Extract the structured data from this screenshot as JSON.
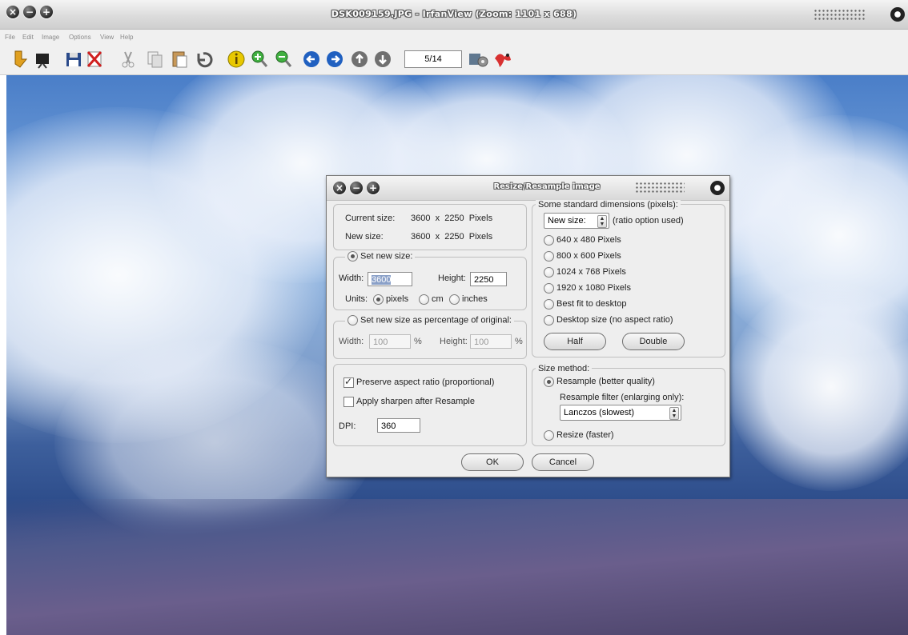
{
  "window": {
    "title": "DSK009159.JPG - IrfanView (Zoom: 1101 x 688)",
    "menu": [
      "File",
      "Edit",
      "Image",
      "Options",
      "View",
      "Help"
    ],
    "page_counter": "5/14"
  },
  "toolbar_icons": [
    "open-folder-icon",
    "slideshow-icon",
    "save-icon",
    "delete-icon",
    "cut-icon",
    "copy-icon",
    "paste-icon",
    "undo-icon",
    "info-icon",
    "zoom-in-icon",
    "zoom-out-icon",
    "previous-icon",
    "next-icon",
    "first-icon",
    "last-icon",
    "settings-icon",
    "irfanview-logo-icon"
  ],
  "dialog": {
    "title": "Resize/Resample image",
    "current_size_label": "Current size:",
    "current_size_value": "3600  x  2250  Pixels",
    "new_size_label": "New size:",
    "new_size_value": "3600  x  2250  Pixels",
    "set_new_size": {
      "label": "Set new size:",
      "selected": true,
      "width_label": "Width:",
      "width_value": "3600",
      "height_label": "Height:",
      "height_value": "2250",
      "units_label": "Units:",
      "units": [
        "pixels",
        "cm",
        "inches"
      ],
      "selected_unit": "pixels"
    },
    "percentage": {
      "label": "Set new size as percentage of original:",
      "selected": false,
      "width_label": "Width:",
      "width_value": "100",
      "height_label": "Height:",
      "height_value": "100",
      "unit": "%"
    },
    "options": {
      "preserve_aspect": "Preserve aspect ratio (proportional)",
      "preserve_checked": true,
      "sharpen": "Apply sharpen after Resample",
      "sharpen_checked": false,
      "dpi_label": "DPI:",
      "dpi_value": "360"
    },
    "standard": {
      "legend": "Some standard dimensions (pixels):",
      "dropdown_value": "New size:",
      "ratio_note": "(ratio option used)",
      "presets": [
        "640 x 480 Pixels",
        "800 x 600 Pixels",
        "1024 x 768 Pixels",
        "1920 x 1080 Pixels",
        "Best fit to desktop",
        "Desktop size (no aspect ratio)"
      ],
      "half": "Half",
      "double": "Double"
    },
    "method": {
      "legend": "Size method:",
      "resample": "Resample (better quality)",
      "resample_selected": true,
      "filter_label": "Resample filter (enlarging only):",
      "filter_value": "Lanczos (slowest)",
      "resize": "Resize (faster)"
    },
    "ok": "OK",
    "cancel": "Cancel"
  }
}
